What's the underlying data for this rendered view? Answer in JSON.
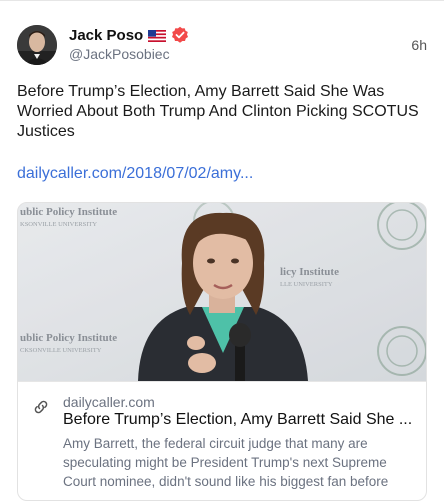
{
  "post": {
    "author": {
      "display_name": "Jack Poso",
      "handle": "@JackPosobiec",
      "flag_icon": "us-flag-icon",
      "verified_icon": "verified-badge-icon",
      "verified_color": "#f24a4a"
    },
    "timestamp": "6h",
    "text": "Before Trump’s Election, Amy Barrett Said She Was Worried About Both Trump And Clinton Picking SCOTUS Justices",
    "link_text": "dailycaller.com/2018/07/02/amy...",
    "link_color": "#3b6fd8"
  },
  "card": {
    "image_banner_left_top": "ublic Policy Institute",
    "image_banner_left_top_sub": "KSONVILLE UNIVERSITY",
    "image_banner_right": "licy Institute",
    "image_banner_right_sub": "LLE UNIVERSITY",
    "image_banner_left_bottom": "ublic Policy Institute",
    "image_banner_left_bottom_sub": "CKSONVILLE UNIVERSITY",
    "link_icon": "link-chain-icon",
    "domain": "dailycaller.com",
    "title": "Before Trump’s Election, Amy Barrett Said She ...",
    "description": "Amy Barrett, the federal circuit judge that many are speculating might be President Trump's next Supreme Court nominee, didn't sound like his biggest fan before"
  }
}
